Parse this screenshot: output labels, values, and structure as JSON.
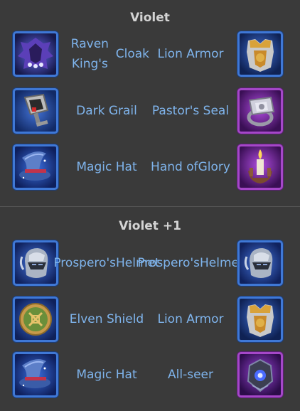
{
  "sections": [
    {
      "title": "Violet",
      "rows": [
        {
          "left": {
            "name": "Raven King's Cloak",
            "icon": "raven-cloak-icon",
            "rarity": "blue"
          },
          "right": {
            "name": "Lion Armor",
            "icon": "lion-armor-icon",
            "rarity": "blue"
          }
        },
        {
          "left": {
            "name": "Dark Grail",
            "icon": "dark-grail-icon",
            "rarity": "blue"
          },
          "right": {
            "name": "Pastor's Seal",
            "icon": "pastor-seal-icon",
            "rarity": "purple"
          }
        },
        {
          "left": {
            "name": "Magic Hat",
            "icon": "magic-hat-icon",
            "rarity": "blue"
          },
          "right": {
            "name": "Hand of Glory",
            "icon": "hand-of-glory-icon",
            "rarity": "purple"
          }
        }
      ]
    },
    {
      "title": "Violet +1",
      "rows": [
        {
          "left": {
            "name": "Prospero's Helmet",
            "icon": "prospero-helmet-icon",
            "rarity": "blue"
          },
          "right": {
            "name": "Prospero's Helmet",
            "icon": "prospero-helmet-icon",
            "rarity": "blue"
          }
        },
        {
          "left": {
            "name": "Elven Shield",
            "icon": "elven-shield-icon",
            "rarity": "blue"
          },
          "right": {
            "name": "Lion Armor",
            "icon": "lion-armor-icon",
            "rarity": "blue"
          }
        },
        {
          "left": {
            "name": "Magic Hat",
            "icon": "magic-hat-icon",
            "rarity": "blue"
          },
          "right": {
            "name": "All-seer",
            "icon": "all-seer-icon",
            "rarity": "purple"
          }
        }
      ]
    }
  ],
  "colors": {
    "background": "#3a3a3a",
    "title": "#d4d4d4",
    "item_name": "#7fb4ec",
    "rarity_blue": "#3f78d6",
    "rarity_purple": "#a547c8"
  }
}
